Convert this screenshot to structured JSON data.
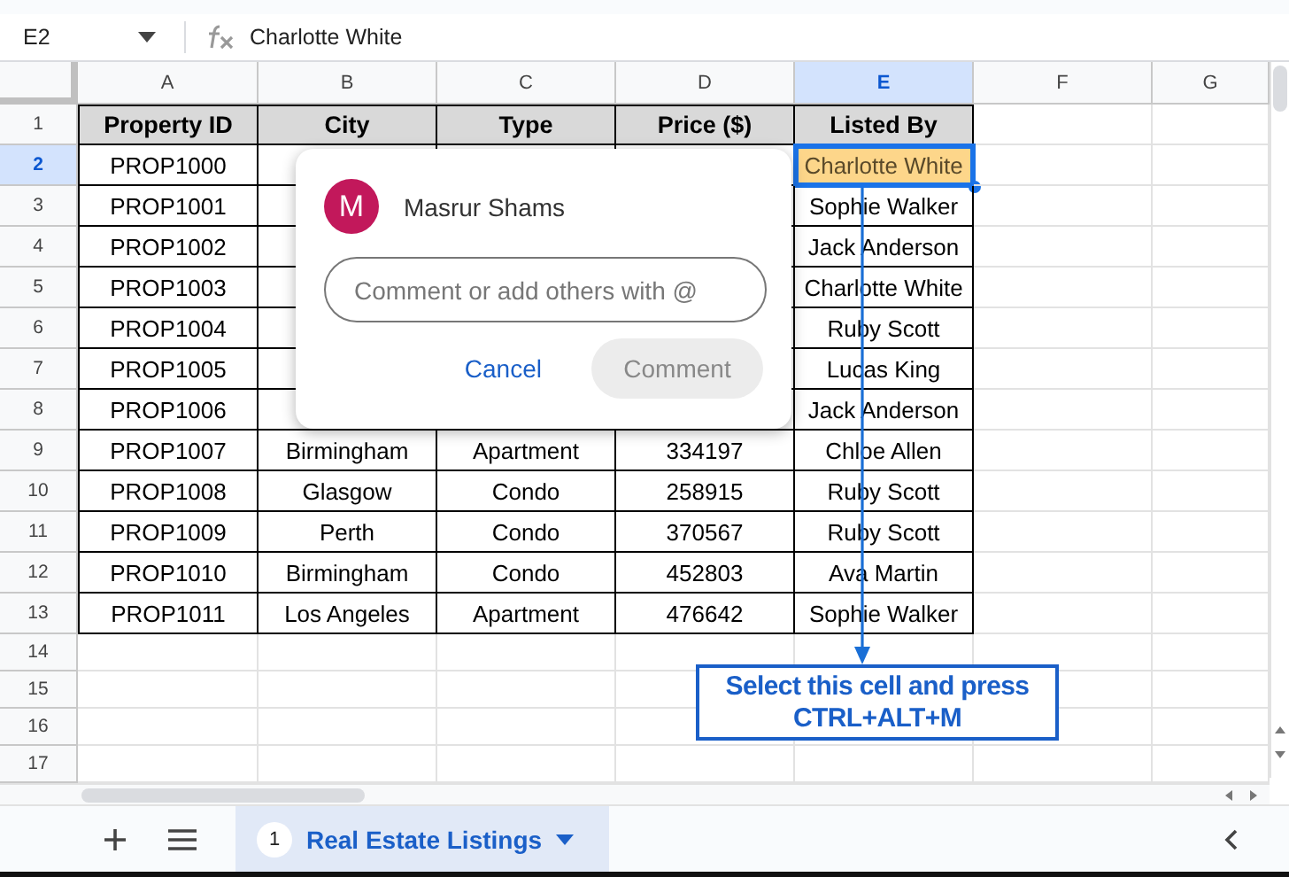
{
  "name_box": {
    "value": "E2"
  },
  "formula_bar": {
    "value": "Charlotte White"
  },
  "columns": [
    {
      "label": "A",
      "selected": false
    },
    {
      "label": "B",
      "selected": false
    },
    {
      "label": "C",
      "selected": false
    },
    {
      "label": "D",
      "selected": false
    },
    {
      "label": "E",
      "selected": true
    },
    {
      "label": "F",
      "selected": false
    },
    {
      "label": "G",
      "selected": false
    }
  ],
  "rows": [
    {
      "number": "1",
      "selected": false,
      "kind": "header",
      "cells": {
        "A": {
          "text": "Property ID",
          "selected": false
        },
        "B": {
          "text": "City",
          "selected": false
        },
        "C": {
          "text": "Type",
          "selected": false
        },
        "D": {
          "text": "Price ($)",
          "selected": false
        },
        "E": {
          "text": "Listed By",
          "selected": false
        }
      }
    },
    {
      "number": "2",
      "selected": true,
      "kind": "data",
      "cells": {
        "A": {
          "text": "PROP1000",
          "selected": false
        },
        "E": {
          "text": "Charlotte White",
          "selected": true
        }
      }
    },
    {
      "number": "3",
      "selected": false,
      "kind": "data",
      "cells": {
        "A": {
          "text": "PROP1001",
          "selected": false
        },
        "E": {
          "text": "Sophie Walker",
          "selected": false
        }
      }
    },
    {
      "number": "4",
      "selected": false,
      "kind": "data",
      "cells": {
        "A": {
          "text": "PROP1002",
          "selected": false
        },
        "E": {
          "text": "Jack Anderson",
          "selected": false
        }
      }
    },
    {
      "number": "5",
      "selected": false,
      "kind": "data",
      "cells": {
        "A": {
          "text": "PROP1003",
          "selected": false
        },
        "E": {
          "text": "Charlotte White",
          "selected": false
        }
      }
    },
    {
      "number": "6",
      "selected": false,
      "kind": "data",
      "cells": {
        "A": {
          "text": "PROP1004",
          "selected": false
        },
        "E": {
          "text": "Ruby Scott",
          "selected": false
        }
      }
    },
    {
      "number": "7",
      "selected": false,
      "kind": "data",
      "cells": {
        "A": {
          "text": "PROP1005",
          "selected": false
        },
        "E": {
          "text": "Lucas King",
          "selected": false
        }
      }
    },
    {
      "number": "8",
      "selected": false,
      "kind": "data",
      "cells": {
        "A": {
          "text": "PROP1006",
          "selected": false
        },
        "E": {
          "text": "Jack Anderson",
          "selected": false
        }
      }
    },
    {
      "number": "9",
      "selected": false,
      "kind": "data",
      "cells": {
        "A": {
          "text": "PROP1007",
          "selected": false
        },
        "B": {
          "text": "Birmingham",
          "selected": false
        },
        "C": {
          "text": "Apartment",
          "selected": false
        },
        "D": {
          "text": "334197",
          "selected": false
        },
        "E": {
          "text": "Chloe Allen",
          "selected": false
        }
      }
    },
    {
      "number": "10",
      "selected": false,
      "kind": "data",
      "cells": {
        "A": {
          "text": "PROP1008",
          "selected": false
        },
        "B": {
          "text": "Glasgow",
          "selected": false
        },
        "C": {
          "text": "Condo",
          "selected": false
        },
        "D": {
          "text": "258915",
          "selected": false
        },
        "E": {
          "text": "Ruby Scott",
          "selected": false
        }
      }
    },
    {
      "number": "11",
      "selected": false,
      "kind": "data",
      "cells": {
        "A": {
          "text": "PROP1009",
          "selected": false
        },
        "B": {
          "text": "Perth",
          "selected": false
        },
        "C": {
          "text": "Condo",
          "selected": false
        },
        "D": {
          "text": "370567",
          "selected": false
        },
        "E": {
          "text": "Ruby Scott",
          "selected": false
        }
      }
    },
    {
      "number": "12",
      "selected": false,
      "kind": "data",
      "cells": {
        "A": {
          "text": "PROP1010",
          "selected": false
        },
        "B": {
          "text": "Birmingham",
          "selected": false
        },
        "C": {
          "text": "Condo",
          "selected": false
        },
        "D": {
          "text": "452803",
          "selected": false
        },
        "E": {
          "text": "Ava Martin",
          "selected": false
        }
      }
    },
    {
      "number": "13",
      "selected": false,
      "kind": "data",
      "cells": {
        "A": {
          "text": "PROP1011",
          "selected": false
        },
        "B": {
          "text": "Los Angeles",
          "selected": false
        },
        "C": {
          "text": "Apartment",
          "selected": false
        },
        "D": {
          "text": "476642",
          "selected": false
        },
        "E": {
          "text": "Sophie Walker",
          "selected": false
        }
      }
    },
    {
      "number": "14",
      "selected": false,
      "kind": "empty"
    },
    {
      "number": "15",
      "selected": false,
      "kind": "empty"
    },
    {
      "number": "16",
      "selected": false,
      "kind": "empty"
    },
    {
      "number": "17",
      "selected": false,
      "kind": "empty"
    }
  ],
  "comment_popup": {
    "avatar_letter": "M",
    "author": "Masrur Shams",
    "placeholder": "Comment or add others with @",
    "buttons": [
      {
        "label": "Cancel",
        "kind": "text",
        "disabled": false
      },
      {
        "label": "Comment",
        "kind": "filled",
        "disabled": true
      }
    ]
  },
  "callout": {
    "text": "Select this cell and press CTRL+ALT+M"
  },
  "sheet_tabs": [
    {
      "badge": "1",
      "label": "Real Estate Listings",
      "selected": true
    }
  ]
}
